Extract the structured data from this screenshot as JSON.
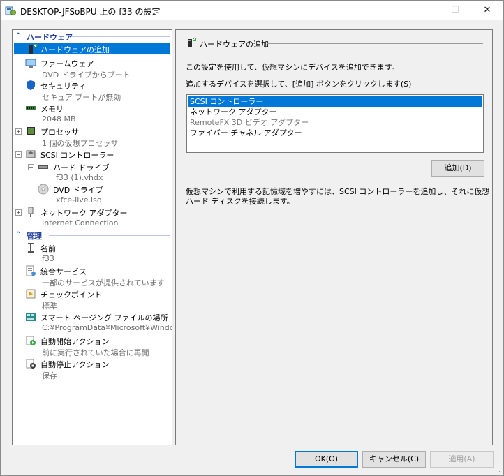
{
  "window": {
    "title": "DESKTOP-JFSoBPU 上の f33 の設定",
    "controls": {
      "minimize": "—",
      "maximize": "☐",
      "close": "✕"
    }
  },
  "sidebar": {
    "hardware_header": "ハードウェア",
    "management_header": "管理",
    "hardware_items": [
      {
        "name": "ハードウェアの追加",
        "sub": "",
        "icon": "add-hardware-icon",
        "selected": true
      },
      {
        "name": "ファームウェア",
        "sub": "DVD ドライブからブート",
        "icon": "firmware-icon"
      },
      {
        "name": "セキュリティ",
        "sub": "セキュア ブートが無効",
        "icon": "shield-icon"
      },
      {
        "name": "メモリ",
        "sub": "2048 MB",
        "icon": "memory-icon"
      },
      {
        "name": "プロセッサ",
        "sub": "1 個の仮想プロセッサ",
        "icon": "processor-icon",
        "expander": "+"
      },
      {
        "name": "SCSI コントローラー",
        "sub": "",
        "icon": "scsi-controller-icon",
        "expander": "−"
      },
      {
        "name": "ハード ドライブ",
        "sub": "f33 (1).vhdx",
        "icon": "hard-drive-icon",
        "expander": "+"
      },
      {
        "name": "DVD ドライブ",
        "sub": "xfce-live.iso",
        "icon": "dvd-drive-icon"
      },
      {
        "name": "ネットワーク アダプター",
        "sub": "Internet Connection",
        "icon": "network-adapter-icon",
        "expander": "+"
      }
    ],
    "management_items": [
      {
        "name": "名前",
        "sub": "f33",
        "icon": "name-icon"
      },
      {
        "name": "統合サービス",
        "sub": "一部のサービスが提供されています",
        "icon": "integration-services-icon"
      },
      {
        "name": "チェックポイント",
        "sub": "標準",
        "icon": "checkpoint-icon"
      },
      {
        "name": "スマート ページング ファイルの場所",
        "sub": "C:¥ProgramData¥Microsoft¥Windo...",
        "icon": "smart-paging-icon"
      },
      {
        "name": "自動開始アクション",
        "sub": "前に実行されていた場合に再開",
        "icon": "auto-start-icon"
      },
      {
        "name": "自動停止アクション",
        "sub": "保存",
        "icon": "auto-stop-icon"
      }
    ]
  },
  "main": {
    "group_title": "ハードウェアの追加",
    "description1": "この設定を使用して、仮想マシンにデバイスを追加できます。",
    "description2": "追加するデバイスを選択して、[追加] ボタンをクリックします(S)",
    "devices": [
      {
        "label": "SCSI コントローラー",
        "state": "selected"
      },
      {
        "label": "ネットワーク アダプター",
        "state": "normal"
      },
      {
        "label": "RemoteFX 3D ビデオ アダプター",
        "state": "disabled"
      },
      {
        "label": "ファイバー チャネル アダプター",
        "state": "normal"
      }
    ],
    "add_button": "追加(D)",
    "info": "仮想マシンで利用する記憶域を増やすには、SCSI コントローラーを追加し、それに仮想",
    "info2": "ハード ディスクを接続します。"
  },
  "footer": {
    "ok": "OK(O)",
    "cancel": "キャンセル(C)",
    "apply": "適用(A)"
  },
  "colors": {
    "selection": "#0078d7",
    "section_header": "#1e3f9a"
  }
}
